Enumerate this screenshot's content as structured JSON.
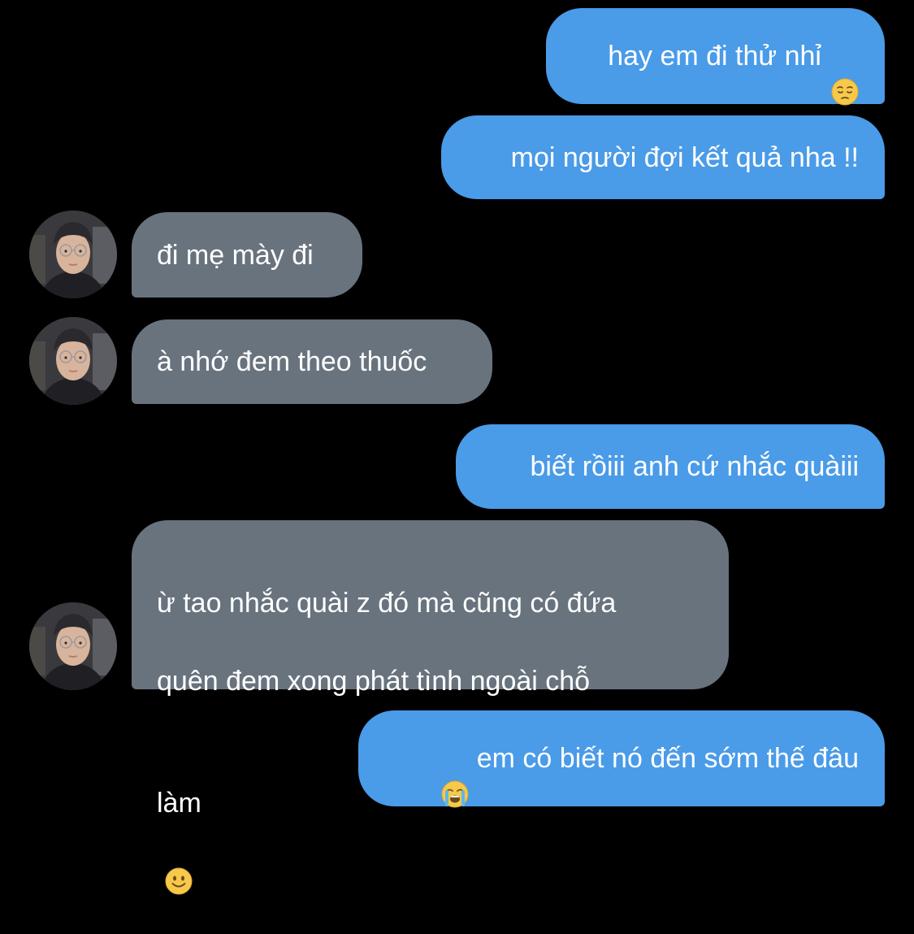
{
  "messages": [
    {
      "id": "m1",
      "direction": "sent",
      "text": "hay em đi thử nhỉ",
      "emoji_after": "pensive-face-icon"
    },
    {
      "id": "m2",
      "direction": "sent",
      "text": "mọi người đợi kết quả nha !!"
    },
    {
      "id": "m3",
      "direction": "received",
      "text": "đi mẹ mày đi"
    },
    {
      "id": "m4",
      "direction": "received",
      "text": "à nhớ đem theo thuốc"
    },
    {
      "id": "m5",
      "direction": "sent",
      "text": "biết rồiii anh cứ nhắc quàiii"
    },
    {
      "id": "m6",
      "direction": "received",
      "lines": [
        "ừ tao nhắc quài z đó mà cũng có đứa",
        "quên đem xong phát tình ngoài chỗ",
        "làm"
      ],
      "emoji_after": "slightly-smiling-face-icon"
    },
    {
      "id": "m7",
      "direction": "sent",
      "text": "em có biết nó đến sớm thế đâu",
      "emoji_before": "loudly-crying-face-icon"
    }
  ],
  "colors": {
    "background": "#000000",
    "sent_bubble": "#4a9be8",
    "received_bubble": "#68737e",
    "text": "#ffffff"
  }
}
